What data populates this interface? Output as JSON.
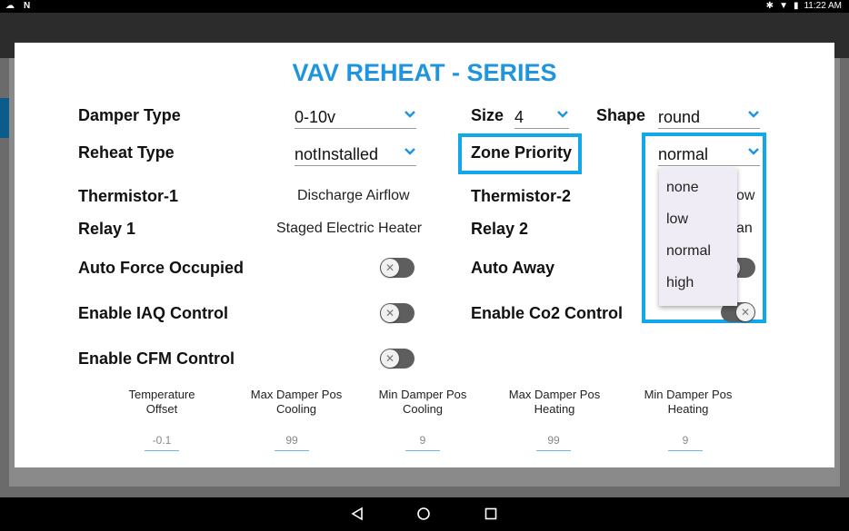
{
  "status_bar": {
    "time": "11:22 AM"
  },
  "dialog": {
    "title": "VAV REHEAT - SERIES",
    "damper_type": {
      "label": "Damper Type",
      "value": "0-10v"
    },
    "size": {
      "label": "Size",
      "value": "4"
    },
    "shape": {
      "label": "Shape",
      "value": "round"
    },
    "reheat_type": {
      "label": "Reheat Type",
      "value": "notInstalled"
    },
    "zone_priority": {
      "label": "Zone Priority",
      "value": "normal",
      "options": [
        "none",
        "low",
        "normal",
        "high"
      ]
    },
    "thermistor1": {
      "label": "Thermistor-1",
      "value": "Discharge Airflow"
    },
    "thermistor2": {
      "label": "Thermistor-2",
      "value_fragment": "ow"
    },
    "relay1": {
      "label": "Relay 1",
      "value": "Staged Electric Heater"
    },
    "relay2": {
      "label": "Relay 2",
      "value_fragment": "an"
    },
    "auto_force_occupied": {
      "label": "Auto Force Occupied",
      "on": false
    },
    "auto_away": {
      "label": "Auto Away",
      "on": false
    },
    "enable_iaq": {
      "label": "Enable IAQ Control",
      "on": false
    },
    "enable_co2": {
      "label": "Enable Co2 Control",
      "on": false
    },
    "enable_cfm": {
      "label": "Enable CFM Control",
      "on": false
    },
    "bottom_fields": [
      {
        "line1": "Temperature",
        "line2": "Offset",
        "value": "-0.1"
      },
      {
        "line1": "Max Damper Pos",
        "line2": "Cooling",
        "value": "99"
      },
      {
        "line1": "Min Damper Pos",
        "line2": "Cooling",
        "value": "9"
      },
      {
        "line1": "Max Damper Pos",
        "line2": "Heating",
        "value": "99"
      },
      {
        "line1": "Min Damper Pos",
        "line2": "Heating",
        "value": "9"
      }
    ]
  },
  "colors": {
    "accent": "#1f95e0",
    "highlight": "#10a8e8",
    "toggle_off": "#5e5e5e"
  }
}
